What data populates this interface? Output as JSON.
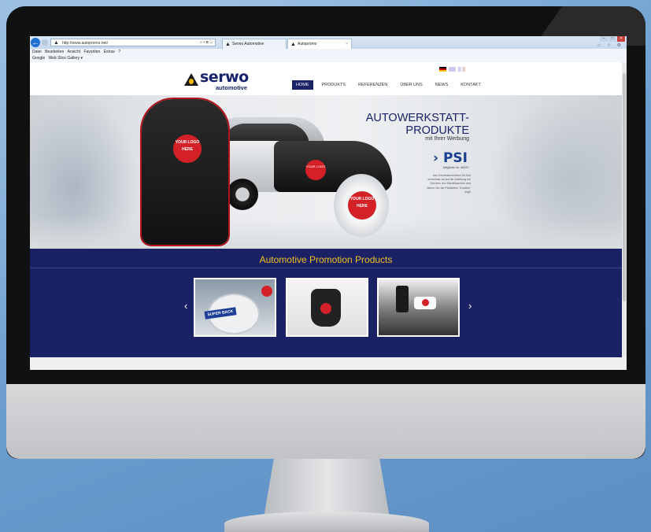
{
  "browser": {
    "address": "http://www.autopromo.net/",
    "address_tools": "⌕ ▾ ⊠ ↻",
    "tabs": [
      {
        "label": "Serwo Automotive",
        "icon": "site-icon"
      },
      {
        "label": "Autopromo",
        "icon": "site-icon"
      }
    ],
    "menu": [
      "Datei",
      "Bearbeiten",
      "Ansicht",
      "Favoriten",
      "Extras",
      "?"
    ],
    "favorites": [
      "Google",
      "Web Slice Gallery ▾"
    ],
    "window_controls": [
      "–",
      "□",
      "✕"
    ],
    "toolbar_icons": "⌂ ☆ ⚙"
  },
  "site": {
    "logo": {
      "name": "serwo",
      "sub": "automotive"
    },
    "languages": [
      "de",
      "en",
      "fr"
    ],
    "nav": [
      "HOME",
      "PRODUKTS",
      "REFERENZEN",
      "ÜBER UNS",
      "NEWS",
      "KONTAKT"
    ],
    "hero": {
      "title_line1": "AUTOWERKSTATT-",
      "title_line2": "PRODUKTE",
      "subtitle": "mit Ihrer Werbung",
      "psi": "PSI",
      "psi_member": "Mitglieds Nr. 46020",
      "text": "Aus Kenntnisreichtum! Du bist erreichbar an auf die Anleitung bei Drucken von Manteltaschen und fahren Sie die Pfadseiten 'Drucken' liegt!",
      "seat_logo": "YOUR LOGO HERE",
      "bag_logo": "YOUR LOGO HERE"
    },
    "promo": {
      "title": "Automotive Promotion Products",
      "prev": "‹",
      "next": "›",
      "thumb1_label": "SUPER BACK"
    }
  }
}
